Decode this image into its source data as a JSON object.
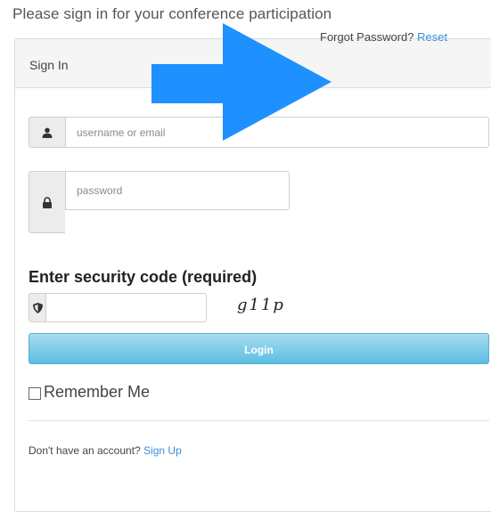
{
  "page": {
    "heading": "Please sign in for your conference participation"
  },
  "panel": {
    "title": "Sign In",
    "forgot_text": "Forgot Password?",
    "reset_link": "Reset"
  },
  "username": {
    "placeholder": "username or email",
    "value": "",
    "icon": "user-icon"
  },
  "password": {
    "placeholder": "password",
    "value": "",
    "icon": "lock-icon"
  },
  "security": {
    "label": "Enter security code (required)",
    "value": "",
    "icon": "shield-icon",
    "captcha": "g11p"
  },
  "login_button": {
    "label": "Login"
  },
  "remember": {
    "label": "Remember Me",
    "checked": false
  },
  "signup": {
    "text": "Don't have an account?",
    "link": "Sign Up"
  },
  "colors": {
    "accent": "#3b8fd9",
    "button": "#5bbfe2",
    "arrow": "#1e90ff"
  }
}
